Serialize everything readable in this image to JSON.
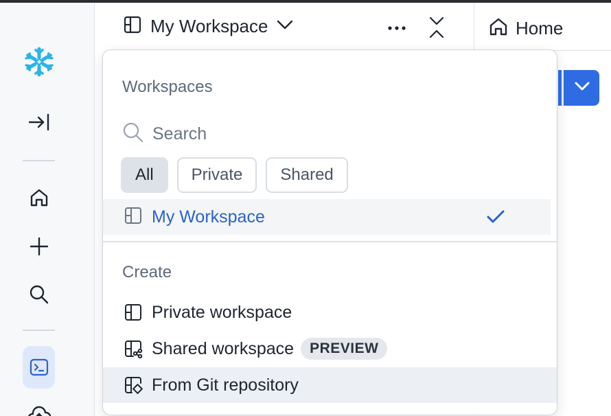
{
  "header": {
    "workspace_title": "My Workspace",
    "home_tab": "Home"
  },
  "dropdown": {
    "workspaces_title": "Workspaces",
    "search_placeholder": "Search",
    "filters": [
      {
        "label": "All",
        "selected": true
      },
      {
        "label": "Private",
        "selected": false
      },
      {
        "label": "Shared",
        "selected": false
      }
    ],
    "workspaces": [
      {
        "label": "My Workspace",
        "checked": true
      }
    ],
    "create_title": "Create",
    "create_items": [
      {
        "label": "Private workspace",
        "icon": "workspace-icon"
      },
      {
        "label": "Shared workspace",
        "icon": "shared-workspace-icon",
        "badge": "PREVIEW"
      },
      {
        "label": "From Git repository",
        "icon": "git-repository-icon"
      }
    ]
  },
  "colors": {
    "accent": "#2f6be3",
    "brand": "#29b5e8",
    "selected_text": "#2a62d0"
  }
}
